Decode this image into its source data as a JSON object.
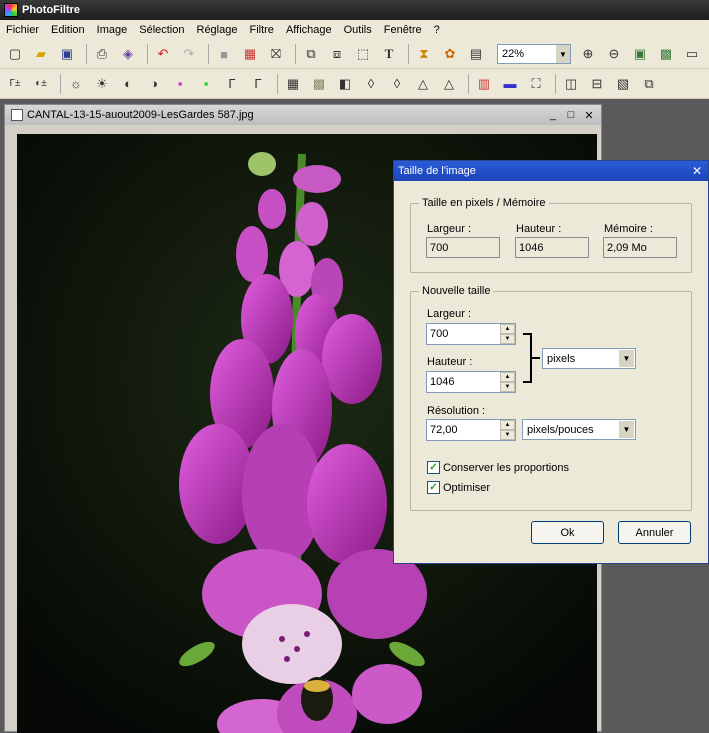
{
  "app": {
    "title": "PhotoFiltre"
  },
  "menu": [
    "Fichier",
    "Edition",
    "Image",
    "Sélection",
    "Réglage",
    "Filtre",
    "Affichage",
    "Outils",
    "Fenêtre",
    "?"
  ],
  "toolbar1_icons": [
    "new-icon",
    "open-icon",
    "save-icon",
    "print-icon",
    "scan-icon",
    "undo-icon",
    "redo-icon",
    "gray-icon",
    "palette-icon",
    "transparency-icon",
    "copy-image-icon",
    "paste-image-icon",
    "select-icon",
    "text-icon",
    "layers-icon",
    "flower-icon",
    "window-icon"
  ],
  "zoom": {
    "value": "22%"
  },
  "toolbar2_icons": [
    "auto-levels-icon",
    "auto-contrast-icon",
    "brightness-down-icon",
    "brightness-up-icon",
    "contrast-down-icon",
    "contrast-up-icon",
    "saturation-down-icon",
    "saturation-up-icon",
    "gamma-down-icon",
    "gamma-up-icon",
    "grid-icon",
    "mosaic-icon",
    "blur-icon",
    "drop-icon",
    "drop2-icon",
    "sharpen-icon",
    "sharpen2-icon",
    "color-icon",
    "monitor-icon",
    "transform-icon",
    "flip-h-icon",
    "flip-v-icon",
    "rotate-icon",
    "resize-icon"
  ],
  "document": {
    "title": "CANTAL-13-15-auout2009-LesGardes 587.jpg"
  },
  "dialog": {
    "title": "Taille de l'image",
    "group1": {
      "legend": "Taille en pixels / Mémoire",
      "width_label": "Largeur :",
      "width": "700",
      "height_label": "Hauteur :",
      "height": "1046",
      "memory_label": "Mémoire :",
      "memory": "2,09 Mo"
    },
    "group2": {
      "legend": "Nouvelle taille",
      "width_label": "Largeur :",
      "width": "700",
      "height_label": "Hauteur :",
      "height": "1046",
      "unit": "pixels",
      "resolution_label": "Résolution :",
      "resolution": "72,00",
      "res_unit": "pixels/pouces",
      "keep_ratio": "Conserver les proportions",
      "optimize": "Optimiser"
    },
    "ok": "Ok",
    "cancel": "Annuler"
  }
}
